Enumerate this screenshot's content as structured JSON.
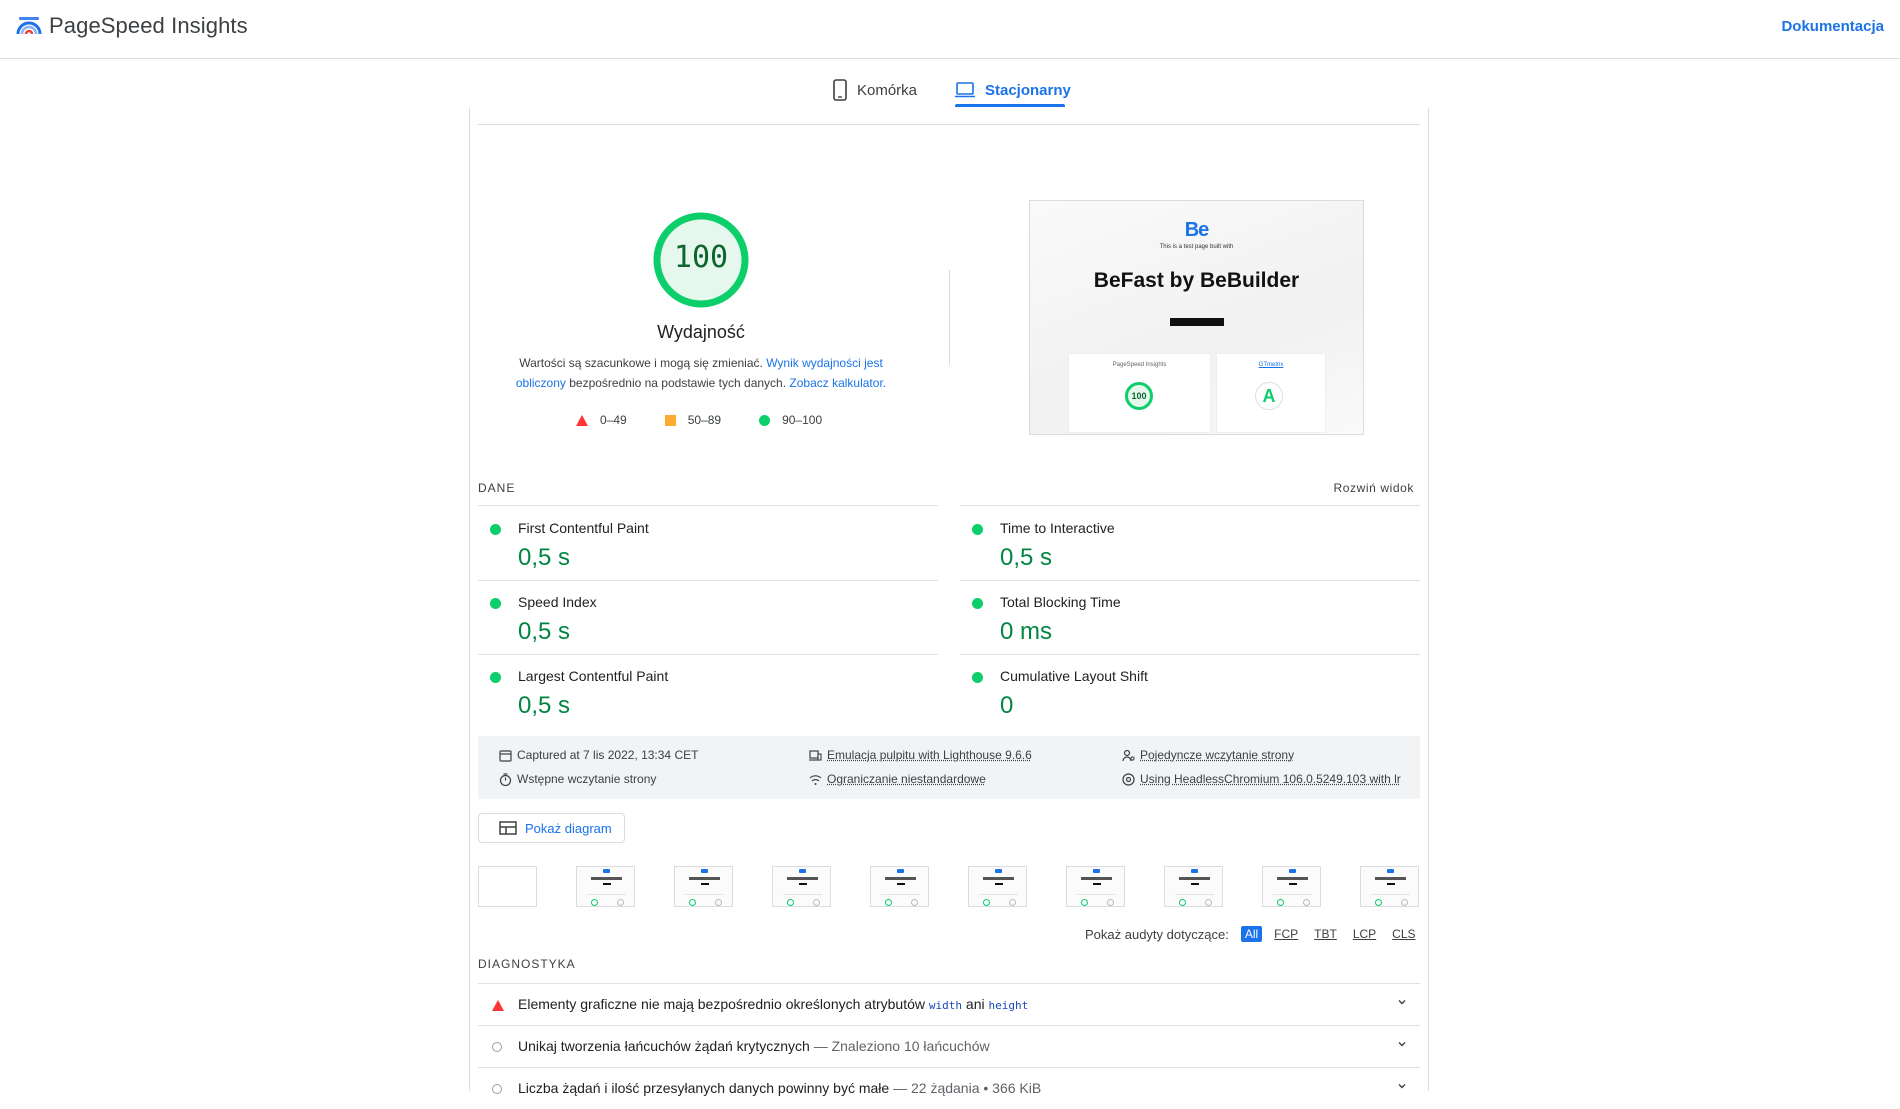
{
  "header": {
    "brand": "PageSpeed Insights",
    "docs_link": "Dokumentacja"
  },
  "tabs": [
    {
      "label": "Komórka",
      "icon": "phone-icon",
      "active": false
    },
    {
      "label": "Stacjonarny",
      "icon": "laptop-icon",
      "active": true
    }
  ],
  "score": {
    "value": "100",
    "title": "Wydajność",
    "desc_part1": "Wartości są szacunkowe i mogą się zmieniać. ",
    "desc_link1": "Wynik wydajności jest obliczony",
    "desc_part2": " bezpośrednio na podstawie tych danych. ",
    "desc_link2": "Zobacz kalkulator.",
    "legend": [
      {
        "range": "0–49",
        "shape": "triangle",
        "color": "#ff3333"
      },
      {
        "range": "50–89",
        "shape": "square",
        "color": "#ffaa33"
      },
      {
        "range": "90–100",
        "shape": "circle",
        "color": "#0cce6b"
      }
    ]
  },
  "preview": {
    "logo": "Be",
    "small_text": "This is a test page built with",
    "title": "BeFast by BeBuilder",
    "card1_label": "PageSpeed Insights",
    "card1_score": "100",
    "card2_label": "GTmetrix",
    "card2_grade": "A"
  },
  "metrics_section": {
    "label": "DANE",
    "expand": "Rozwiń widok",
    "metrics": [
      {
        "name": "First Contentful Paint",
        "value": "0,5 s"
      },
      {
        "name": "Time to Interactive",
        "value": "0,5 s"
      },
      {
        "name": "Speed Index",
        "value": "0,5 s"
      },
      {
        "name": "Total Blocking Time",
        "value": "0 ms"
      },
      {
        "name": "Largest Contentful Paint",
        "value": "0,5 s"
      },
      {
        "name": "Cumulative Layout Shift",
        "value": "0"
      }
    ]
  },
  "info": {
    "captured": "Captured at 7 lis 2022, 13:34 CET",
    "initial_load": "Wstępne wczytanie strony",
    "emulation": "Emulacja pulpitu with Lighthouse 9.6.6",
    "throttling": "Ograniczanie niestandardowe",
    "single_load": "Pojedyncze wczytanie strony",
    "browser": "Using HeadlessChromium 106.0.5249.103 with lr"
  },
  "diagram_button": "Pokaż diagram",
  "filter": {
    "label": "Pokaż audyty dotyczące:",
    "options": [
      "All",
      "FCP",
      "TBT",
      "LCP",
      "CLS"
    ],
    "selected": "All"
  },
  "diagnostics": {
    "label": "DIAGNOSTYKA",
    "audits": [
      {
        "status": "fail",
        "text1": "Elementy graficzne nie mają bezpośrednio określonych atrybutów ",
        "code1": "width",
        "text2": " ani ",
        "code2": "height"
      },
      {
        "status": "info",
        "text": "Unikaj tworzenia łańcuchów żądań krytycznych",
        "sub": " — Znaleziono 10 łańcuchów"
      },
      {
        "status": "info",
        "text": "Liczba żądań i ilość przesyłanych danych powinny być małe",
        "sub": " — 22 żądania • 366 KiB"
      }
    ]
  },
  "colors": {
    "accent": "#1a73e8",
    "pass": "#0cce6b",
    "fail": "#ff3333",
    "average": "#ffaa33",
    "pass_text": "#018642"
  }
}
